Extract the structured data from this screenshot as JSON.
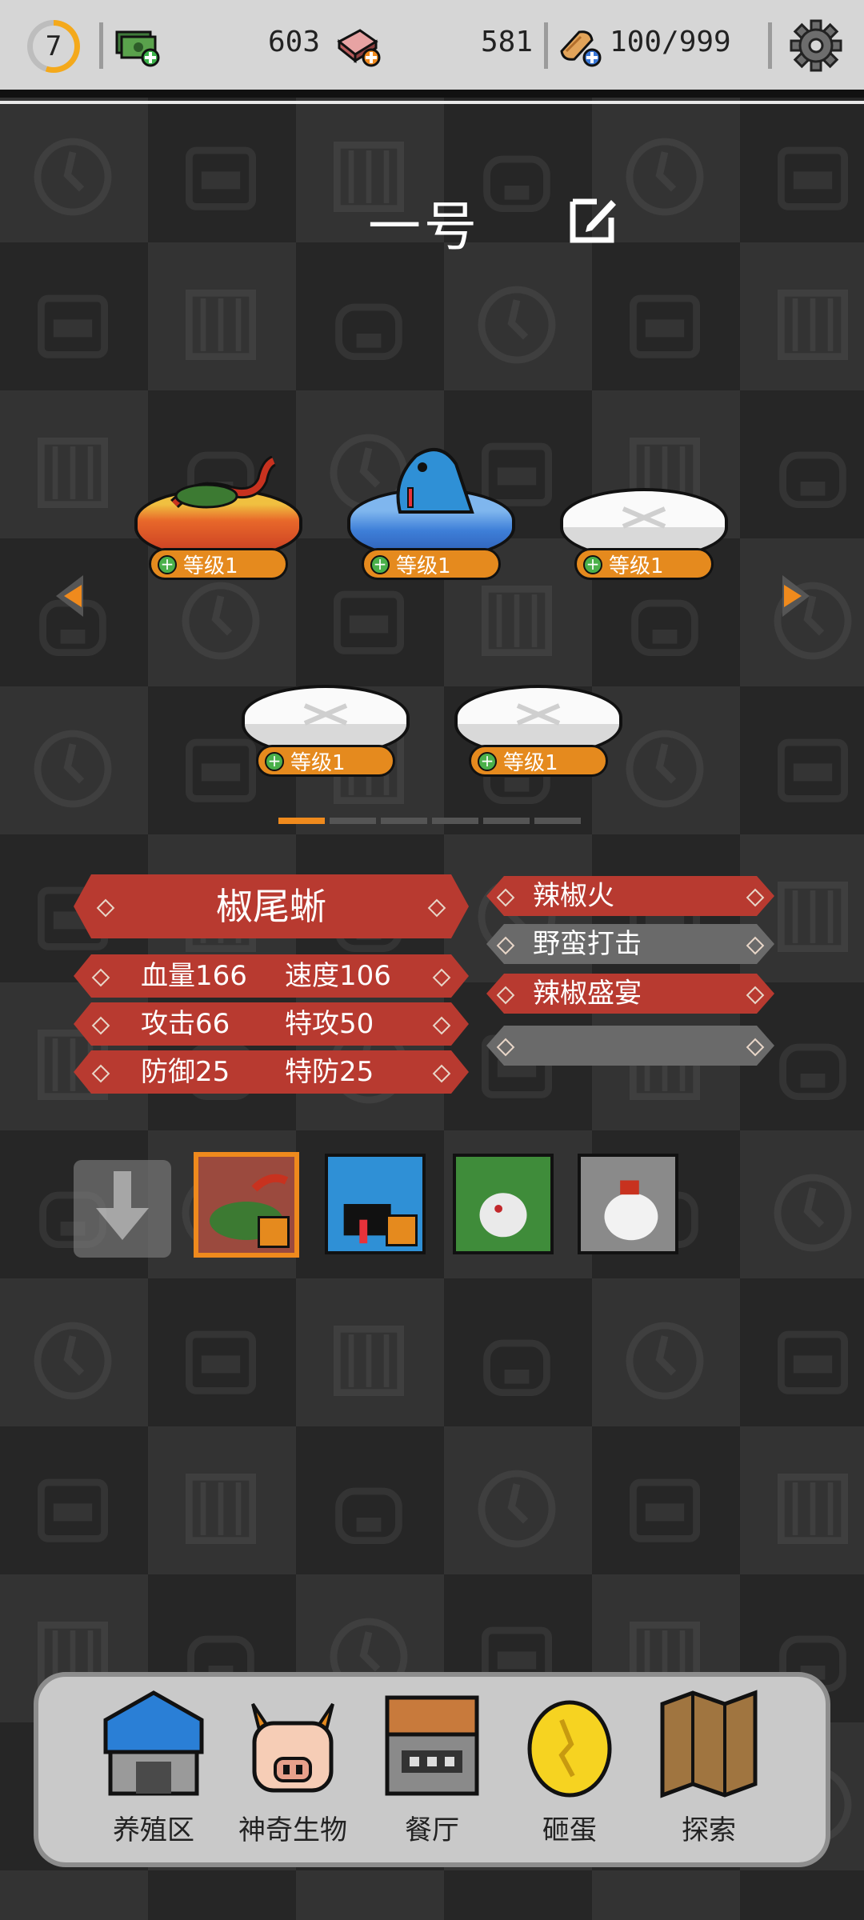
{
  "header": {
    "player_level": "7",
    "resources": [
      {
        "icon": "cash-plus-icon",
        "value": "603"
      },
      {
        "icon": "meat-plus-icon",
        "value": "581"
      },
      {
        "icon": "bread-plus-icon",
        "value": "100/999"
      }
    ],
    "settings_icon": "gear-icon"
  },
  "team": {
    "title": "一号",
    "edit_icon": "edit-icon",
    "slots": [
      {
        "state": "fire",
        "level_label": "等级1"
      },
      {
        "state": "water",
        "level_label": "等级1"
      },
      {
        "state": "empty",
        "level_label": "等级1"
      },
      {
        "state": "empty",
        "level_label": "等级1"
      },
      {
        "state": "empty",
        "level_label": "等级1"
      }
    ],
    "page_count": 6,
    "active_page": 1
  },
  "creature": {
    "name": "椒尾蜥",
    "stats": [
      {
        "left": "血量166",
        "right": "速度106"
      },
      {
        "left": "攻击66",
        "right": "特攻50"
      },
      {
        "left": "防御25",
        "right": "特防25"
      }
    ],
    "skills": [
      {
        "name": "辣椒火",
        "active": true
      },
      {
        "name": "野蛮打击",
        "active": false
      },
      {
        "name": "辣椒盛宴",
        "active": true
      },
      {
        "name": "",
        "active": false
      }
    ]
  },
  "colors": {
    "accent_orange": "#e58a1e",
    "ribbon_red": "#b83a30",
    "ribbon_gray": "#6a6a6a"
  },
  "nav": [
    {
      "label": "养殖区",
      "icon": "farm-icon"
    },
    {
      "label": "神奇生物",
      "icon": "creature-icon"
    },
    {
      "label": "餐厅",
      "icon": "restaurant-icon"
    },
    {
      "label": "砸蛋",
      "icon": "egg-icon"
    },
    {
      "label": "探索",
      "icon": "map-icon"
    }
  ]
}
